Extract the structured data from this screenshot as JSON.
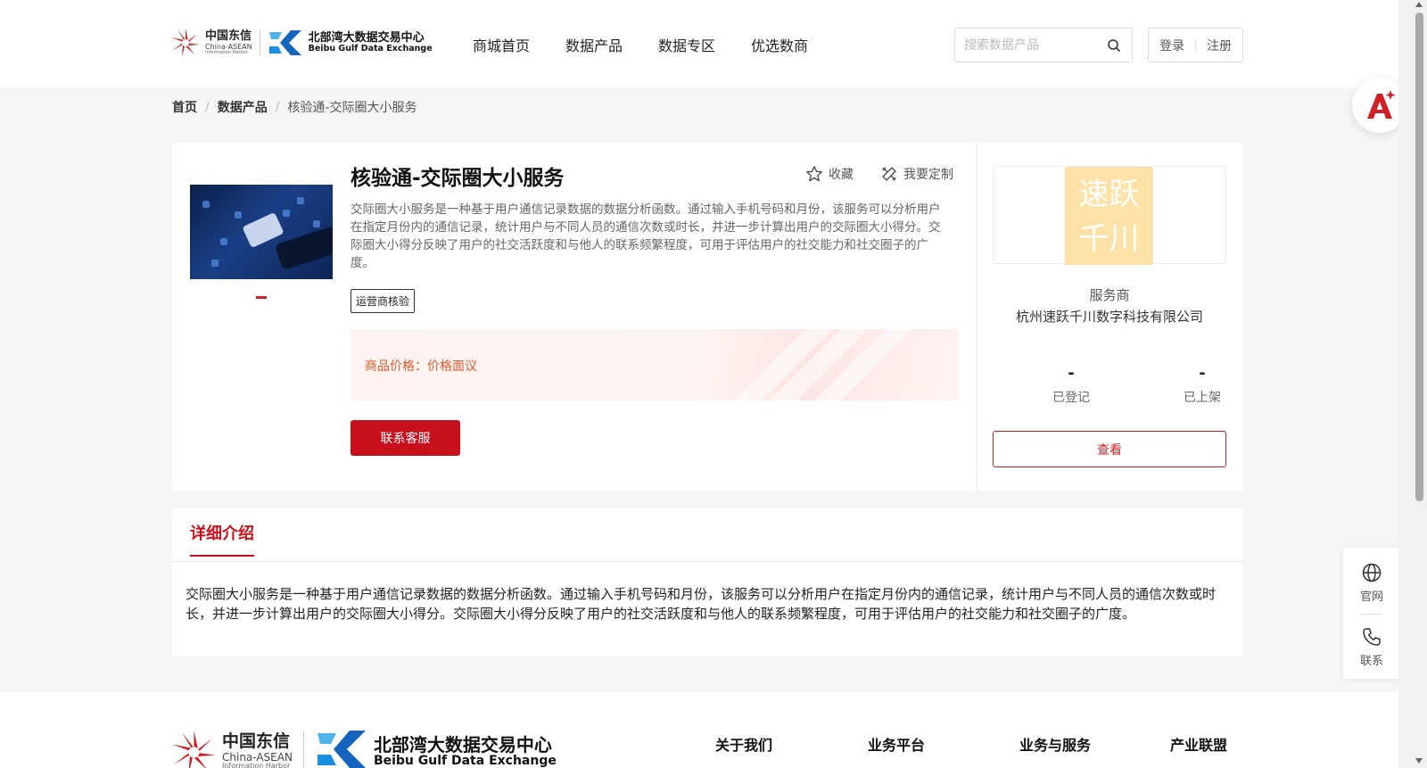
{
  "header": {
    "logo": {
      "telecom_cn": "中国东信",
      "telecom_en": "China-ASEAN",
      "telecom_en2": "Information Harbor",
      "exchange_cn": "北部湾大数据交易中心",
      "exchange_en": "Beibu Gulf Data Exchange"
    },
    "nav": [
      "商城首页",
      "数据产品",
      "数据专区",
      "优选数商"
    ],
    "search": {
      "placeholder": "搜索数据产品",
      "value": ""
    },
    "login": "登录",
    "register": "注册"
  },
  "breadcrumb": {
    "home": "首页",
    "category": "数据产品",
    "current": "核验通-交际圈大小服务"
  },
  "product": {
    "title": "核验通-交际圈大小服务",
    "favorite_label": "收藏",
    "customize_label": "我要定制",
    "description": "交际圈大小服务是一种基于用户通信记录数据的数据分析函数。通过输入手机号码和月份，该服务可以分析用户在指定月份内的通信记录，统计用户与不同人员的通信次数或时长，并进一步计算出用户的交际圈大小得分。交际圈大小得分反映了用户的社交活跃度和与他人的联系频繁程度，可用于评估用户的社交能力和社交圈子的广度。",
    "tag": "运营商核验",
    "price_label": "商品价格：",
    "price_value": "价格面议",
    "contact_button": "联系客服"
  },
  "vendor": {
    "logo_line1": "速跃",
    "logo_line2": "千川",
    "role": "服务商",
    "name": "杭州速跃千川数字科技有限公司",
    "registered_value": "-",
    "registered_label": "已登记",
    "listed_value": "-",
    "listed_label": "已上架",
    "view_button": "查看"
  },
  "detail": {
    "tab": "详细介绍",
    "text": "交际圈大小服务是一种基于用户通信记录数据的数据分析函数。通过输入手机号码和月份，该服务可以分析用户在指定月份内的通信记录，统计用户与不同人员的通信次数或时长，并进一步计算出用户的交际圈大小得分。交际圈大小得分反映了用户的社交活跃度和与他人的联系频繁程度，可用于评估用户的社交能力和社交圈子的广度。"
  },
  "footer": {
    "links": [
      "关于我们",
      "业务平台",
      "业务与服务",
      "产业联盟"
    ]
  },
  "side": {
    "official_site": "官网",
    "contact": "联系"
  },
  "colors": {
    "brand_red": "#c8101d",
    "price_orange": "#e05b2b",
    "vendor_logo_bg": "#fde2a7",
    "exchange_blue": "#1a8fe0"
  }
}
